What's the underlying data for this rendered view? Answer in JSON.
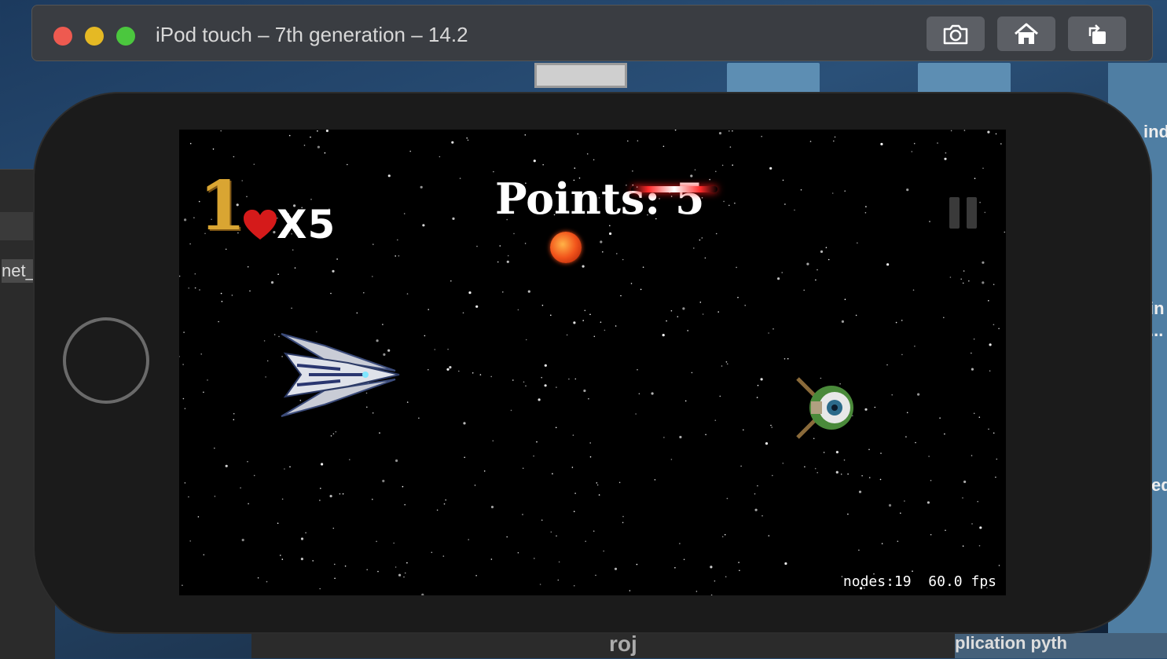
{
  "window": {
    "title": "iPod touch – 7th generation – 14.2",
    "toolbar": {
      "screenshot_icon": "camera-icon",
      "home_icon": "home-icon",
      "rotate_icon": "rotate-icon"
    }
  },
  "background": {
    "left_text": "net_",
    "right_texts": [
      "ind",
      "in",
      "...",
      "ed"
    ],
    "bottom_text": "roj",
    "bottom_right_text": "plication    pyth"
  },
  "game": {
    "level": "1",
    "lives": "X5",
    "points_label": "Points: 5",
    "heart_icon": "heart-icon",
    "pause_icon": "pause-icon",
    "debug": {
      "nodes": "nodes:19",
      "fps": "60.0 fps"
    }
  },
  "colors": {
    "accent_gold": "#d9a532",
    "heart_red": "#d51a1a",
    "laser_red": "#ff2a2a",
    "traffic_red": "#ee5a50",
    "traffic_yellow": "#e5b924",
    "traffic_green": "#4bc73e"
  }
}
